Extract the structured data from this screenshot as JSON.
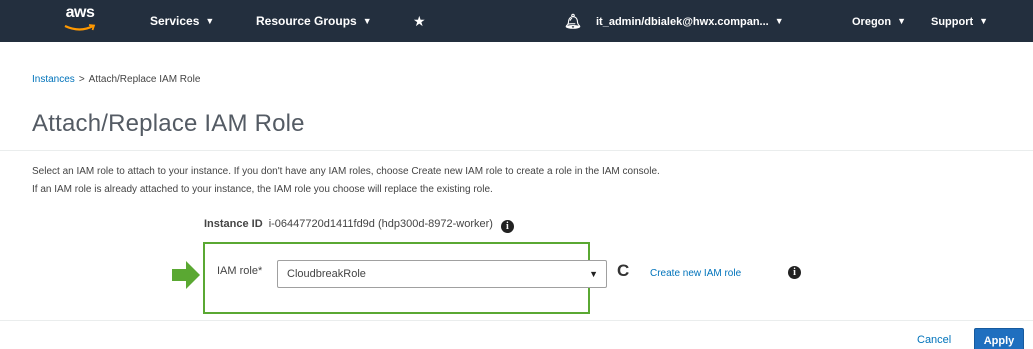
{
  "header": {
    "logo": "aws",
    "services": "Services",
    "resource_groups": "Resource Groups",
    "user": "it_admin/dbialek@hwx.compan...",
    "region": "Oregon",
    "support": "Support"
  },
  "breadcrumb": {
    "parent": "Instances",
    "separator": ">",
    "current": "Attach/Replace IAM Role"
  },
  "page": {
    "title": "Attach/Replace IAM Role",
    "description_line1": "Select an IAM role to attach to your instance. If you don't have any IAM roles, choose Create new IAM role to create a role in the IAM console.",
    "description_line2": "If an IAM role is already attached to your instance, the IAM role you choose will replace the existing role."
  },
  "form": {
    "instance_id_label": "Instance ID",
    "instance_id_value": "i-06447720d1411fd9d (hdp300d-8972-worker)",
    "iam_role_label": "IAM role",
    "required_marker": "*",
    "iam_role_value": "CloudbreakRole",
    "create_link": "Create new IAM role"
  },
  "actions": {
    "cancel": "Cancel",
    "apply": "Apply"
  },
  "colors": {
    "nav_bg": "#232f3e",
    "link": "#0073bb",
    "highlight": "#5aa832",
    "primary_button": "#1f6fbf"
  }
}
